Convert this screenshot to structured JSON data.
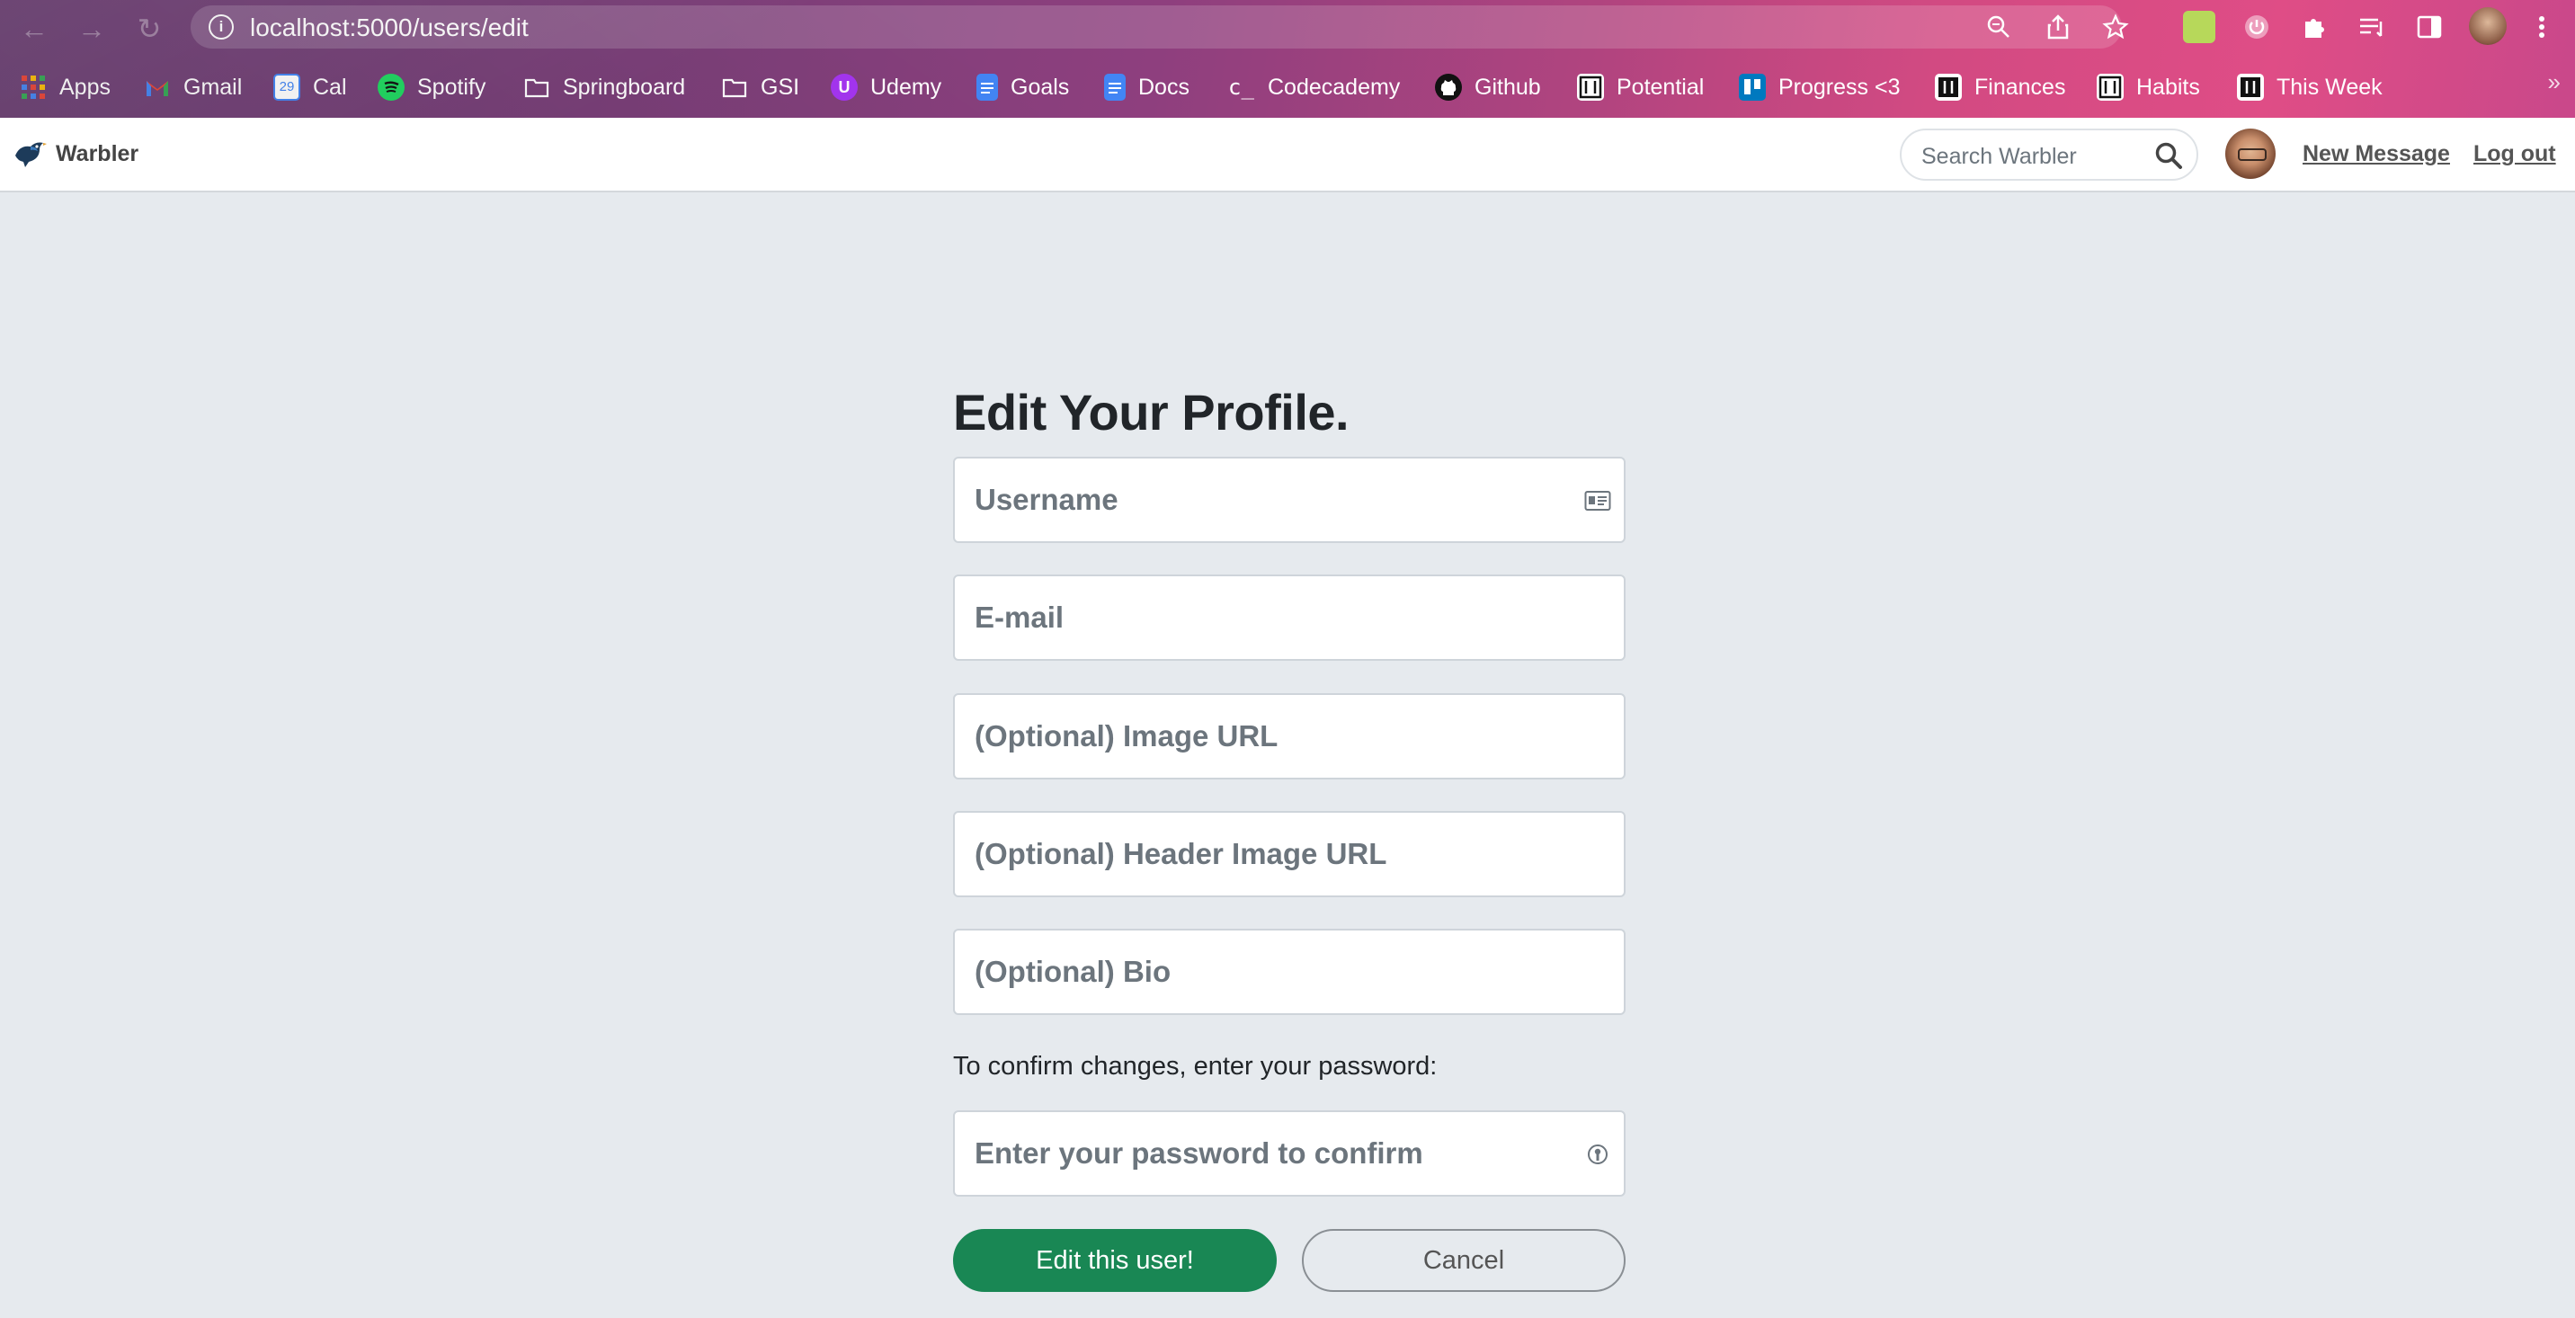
{
  "browser": {
    "url": "localhost:5000/users/edit",
    "bookmarks": [
      {
        "label": "Apps",
        "icon": "apps-grid-icon"
      },
      {
        "label": "Gmail",
        "icon": "gmail-icon"
      },
      {
        "label": "Cal",
        "icon": "calendar-icon"
      },
      {
        "label": "Spotify",
        "icon": "spotify-icon"
      },
      {
        "label": "Springboard",
        "icon": "folder-icon"
      },
      {
        "label": "GSI",
        "icon": "folder-icon"
      },
      {
        "label": "Udemy",
        "icon": "udemy-icon"
      },
      {
        "label": "Goals",
        "icon": "docs-icon"
      },
      {
        "label": "Docs",
        "icon": "docs-icon"
      },
      {
        "label": "Codecademy",
        "icon": "codecademy-icon"
      },
      {
        "label": "Github",
        "icon": "github-icon"
      },
      {
        "label": "Potential",
        "icon": "notion-icon"
      },
      {
        "label": "Progress <3",
        "icon": "trello-icon"
      },
      {
        "label": "Finances",
        "icon": "notion-icon"
      },
      {
        "label": "Habits",
        "icon": "notion-icon"
      },
      {
        "label": "This Week",
        "icon": "notion-icon"
      }
    ],
    "overflow_label": "»"
  },
  "navbar": {
    "brand": "Warbler",
    "search_placeholder": "Search Warbler",
    "new_message": "New Message",
    "logout": "Log out"
  },
  "form": {
    "title": "Edit Your Profile.",
    "username_placeholder": "Username",
    "email_placeholder": "E-mail",
    "image_url_placeholder": "(Optional) Image URL",
    "header_image_url_placeholder": "(Optional) Header Image URL",
    "bio_placeholder": "(Optional) Bio",
    "confirm_text": "To confirm changes, enter your password:",
    "password_placeholder": "Enter your password to confirm",
    "submit_label": "Edit this user!",
    "cancel_label": "Cancel"
  },
  "colors": {
    "page_bg": "#e6eaee",
    "success": "#198754",
    "placeholder": "#6c757d"
  }
}
